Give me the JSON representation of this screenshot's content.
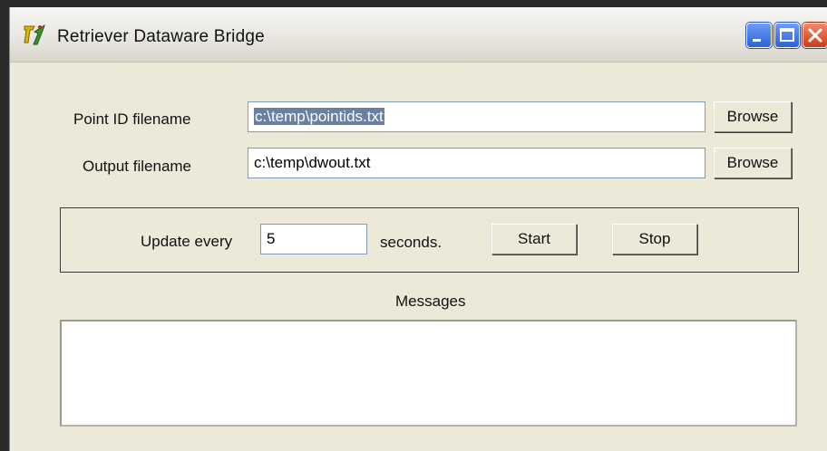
{
  "window": {
    "title": "Retriever Dataware Bridge",
    "icon": "retriever-app-icon"
  },
  "form": {
    "point_id_label": "Point ID filename",
    "point_id_value": "c:\\temp\\pointids.txt",
    "output_label": "Output filename",
    "output_value": "c:\\temp\\dwout.txt",
    "browse_label": "Browse"
  },
  "update": {
    "label": "Update every",
    "value": "5",
    "unit": "seconds.",
    "start_label": "Start",
    "stop_label": "Stop"
  },
  "messages": {
    "label": "Messages"
  },
  "colors": {
    "window_bg": "#ece9d8",
    "title_close": "#cf3a17",
    "title_btn": "#2b62d8",
    "selection": "#6a7fa1"
  }
}
